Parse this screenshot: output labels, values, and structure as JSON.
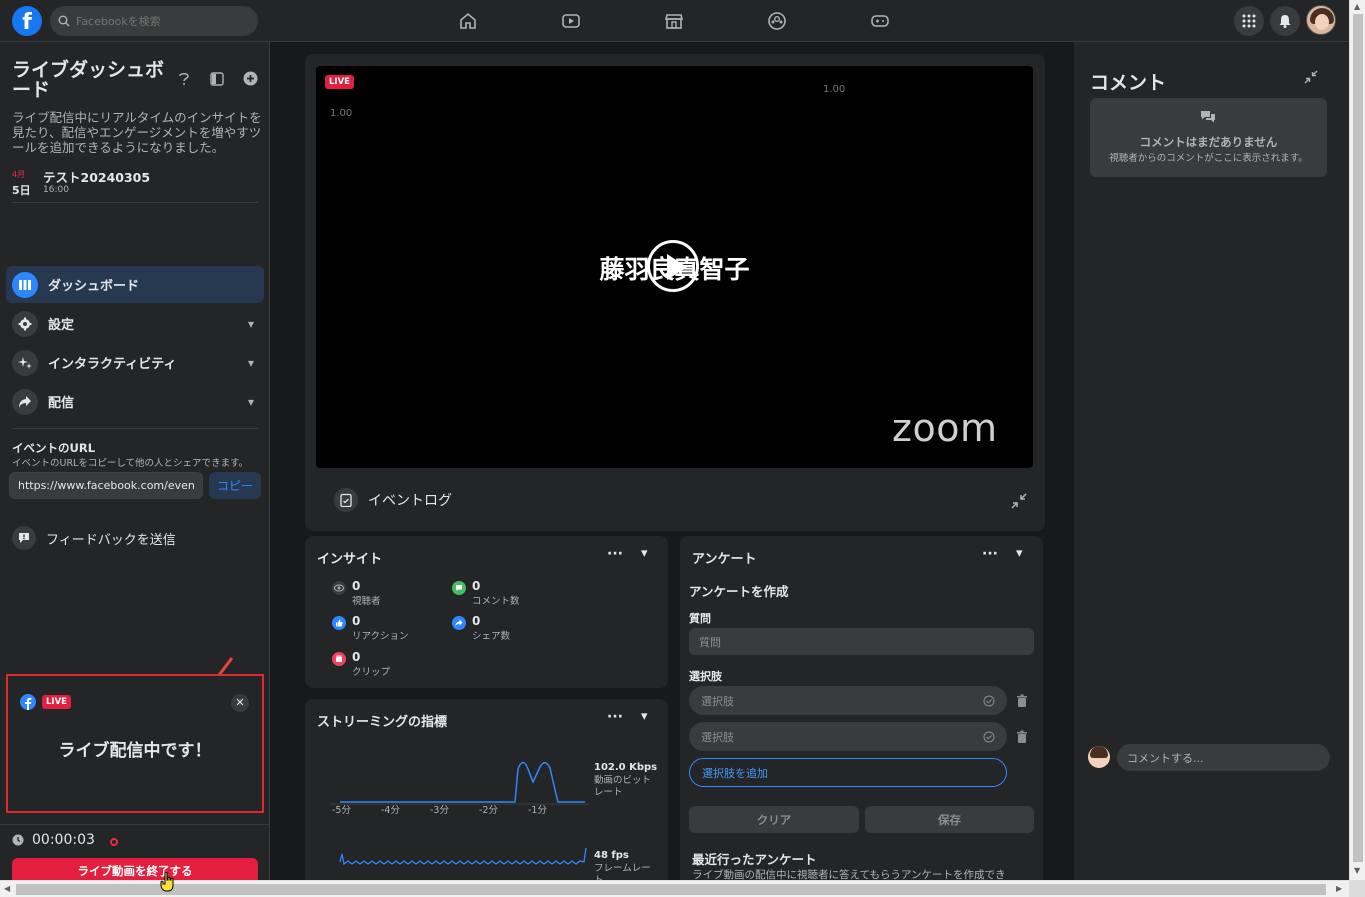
{
  "topbar": {
    "logo": "f",
    "search_placeholder": "Facebookを検索",
    "nav_icons": [
      "home-icon",
      "watch-icon",
      "marketplace-icon",
      "groups-icon",
      "gaming-icon"
    ],
    "right_icons": [
      "menu-grid-icon",
      "notification-bell-icon",
      "profile-avatar"
    ]
  },
  "sidebar": {
    "title": "ライブダッシュボード",
    "description": "ライブ配信中にリアルタイムのインサイトを見たり、配信やエンゲージメントを増やすツールを追加できるようになりました。",
    "event": {
      "month": "4月",
      "day": "5日",
      "name": "テスト20240305",
      "time": "16:00"
    },
    "menu": [
      {
        "label": "ダッシュボード",
        "icon": "dashboard-icon"
      },
      {
        "label": "設定",
        "icon": "gear-icon"
      },
      {
        "label": "インタラクティビティ",
        "icon": "sparkle-icon"
      },
      {
        "label": "配信",
        "icon": "share-arrow-icon"
      }
    ],
    "url_section": {
      "title": "イベントのURL",
      "description": "イベントのURLをコピーして他の人とシェアできます。",
      "url": "https://www.facebook.com/events",
      "copy_label": "コピー"
    },
    "feedback_label": "フィードバックを送信",
    "live_card": {
      "badge": "LIVE",
      "text": "ライブ配信中です！"
    },
    "timer": "00:00:03",
    "end_button": "ライブ動画を終了する"
  },
  "video": {
    "badge": "LIVE",
    "num_left": "1.00",
    "num_right": "1.00",
    "participant_name": "藤羽良真智子",
    "watermark": "zoom",
    "event_log_label": "イベントログ"
  },
  "insights": {
    "title": "インサイト",
    "stats": [
      {
        "value": "0",
        "label": "視聴者",
        "icon": "eye-icon",
        "color": "#b0b3b8"
      },
      {
        "value": "0",
        "label": "コメント数",
        "icon": "comment-icon",
        "color": "#45bd62"
      },
      {
        "value": "0",
        "label": "リアクション",
        "icon": "like-icon",
        "color": "#2d88ff"
      },
      {
        "value": "0",
        "label": "シェア数",
        "icon": "share-icon",
        "color": "#2d88ff"
      },
      {
        "value": "0",
        "label": "クリップ",
        "icon": "clip-icon",
        "color": "#f3425f"
      }
    ]
  },
  "streaming": {
    "title": "ストリーミングの指標",
    "bitrate_value": "102.0 Kbps",
    "bitrate_label": "動画のビットレート",
    "fps_value": "48 fps",
    "fps_label": "フレームレート",
    "x_labels": [
      "-5分",
      "-4分",
      "-3分",
      "-2分",
      "-1分"
    ]
  },
  "poll": {
    "title": "アンケート",
    "create_title": "アンケートを作成",
    "question_label": "質問",
    "question_placeholder": "質問",
    "options_label": "選択肢",
    "option_placeholder": "選択肢",
    "add_option": "選択肢を追加",
    "clear_label": "クリア",
    "save_label": "保存",
    "recent_title": "最近行ったアンケート",
    "recent_desc": "ライブ動画の配信中に視聴者に答えてもらうアンケートを作成でき"
  },
  "comments": {
    "title": "コメント",
    "empty_title": "コメントはまだありません",
    "empty_desc": "視聴者からのコメントがここに表示されます。",
    "input_placeholder": "コメントする..."
  },
  "colors": {
    "accent": "#2d88ff",
    "live": "#e41e3f",
    "bg": "#18191a",
    "card": "#242526"
  }
}
